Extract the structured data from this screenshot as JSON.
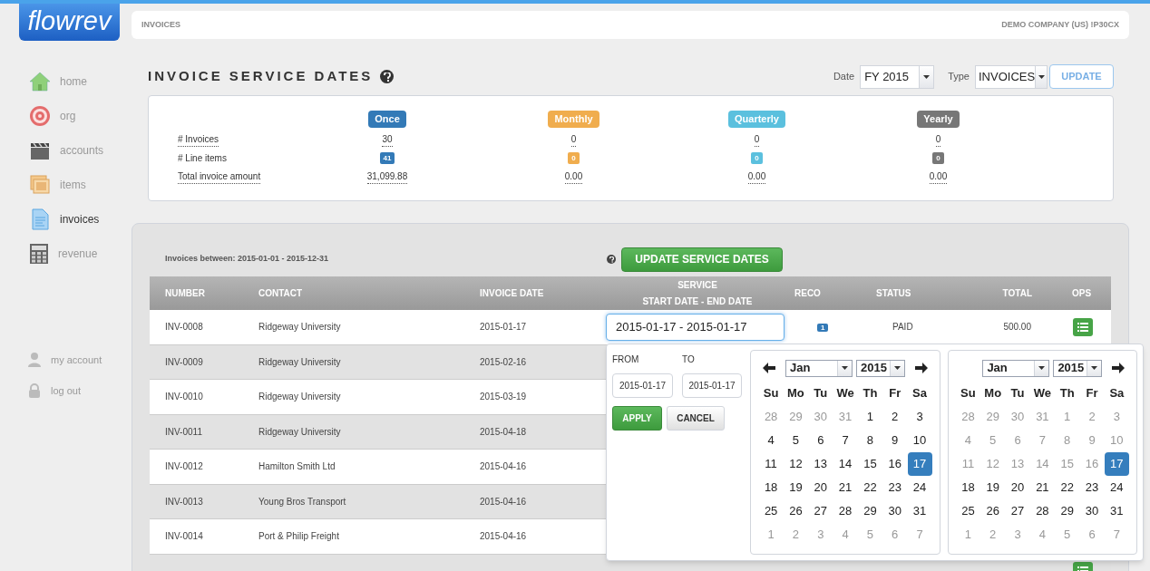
{
  "logo": "flowrev",
  "header": {
    "breadcrumb": "INVOICES",
    "company": "DEMO COMPANY (US) !P30CX"
  },
  "sidebar": {
    "items": [
      {
        "label": "home",
        "kind": "home",
        "selected": false
      },
      {
        "label": "org",
        "kind": "target",
        "selected": false
      },
      {
        "label": "accounts",
        "kind": "clapper",
        "selected": false
      },
      {
        "label": "items",
        "kind": "photos",
        "selected": false
      },
      {
        "label": "invoices",
        "kind": "document",
        "selected": true
      },
      {
        "label": "revenue",
        "kind": "calculator",
        "selected": false
      }
    ],
    "account_items": [
      {
        "label": "my account",
        "kind": "user"
      },
      {
        "label": "log out",
        "kind": "lock"
      }
    ]
  },
  "page_title": "INVOICE SERVICE DATES",
  "filters": {
    "date_label": "Date",
    "date_value": "FY 2015",
    "type_label": "Type",
    "type_value": "INVOICES",
    "update": "UPDATE"
  },
  "summary": {
    "row_labels": [
      "# Invoices",
      "# Line items",
      "Total invoice amount"
    ],
    "columns": [
      {
        "label": "Once",
        "color": "#337ab7",
        "invoices": "30",
        "line_items": "41",
        "total": "31,099.88"
      },
      {
        "label": "Monthly",
        "color": "#f0ad4e",
        "invoices": "0",
        "line_items": "0",
        "total": "0.00"
      },
      {
        "label": "Quarterly",
        "color": "#5bc0de",
        "invoices": "0",
        "line_items": "0",
        "total": "0.00"
      },
      {
        "label": "Yearly",
        "color": "#777777",
        "invoices": "0",
        "line_items": "0",
        "total": "0.00"
      }
    ]
  },
  "invoices_between": "Invoices between: 2015-01-01 - 2015-12-31",
  "update_service_dates": "UPDATE SERVICE DATES",
  "table": {
    "columns": [
      {
        "label": "NUMBER"
      },
      {
        "label": "CONTACT"
      },
      {
        "label": "INVOICE DATE"
      },
      {
        "label": "SERVICE",
        "sublabel": "START DATE - END DATE"
      },
      {
        "label": "RECO"
      },
      {
        "label": "STATUS"
      },
      {
        "label": "TOTAL"
      },
      {
        "label": "OPS"
      }
    ],
    "rows": [
      {
        "number": "INV-0008",
        "contact": "Ridgeway University",
        "invoice_date": "2015-01-17",
        "service": "2015-01-17 - 2015-01-17",
        "reco": "1",
        "status": "PAID",
        "total": "500.00",
        "ops": true
      },
      {
        "number": "INV-0009",
        "contact": "Ridgeway University",
        "invoice_date": "2015-02-16"
      },
      {
        "number": "INV-0010",
        "contact": "Ridgeway University",
        "invoice_date": "2015-03-19"
      },
      {
        "number": "INV-0011",
        "contact": "Ridgeway University",
        "invoice_date": "2015-04-18"
      },
      {
        "number": "INV-0012",
        "contact": "Hamilton Smith Ltd",
        "invoice_date": "2015-04-16"
      },
      {
        "number": "INV-0013",
        "contact": "Young Bros Transport",
        "invoice_date": "2015-04-16"
      },
      {
        "number": "INV-0014",
        "contact": "Port & Philip Freight",
        "invoice_date": "2015-04-16"
      },
      {
        "ops": true
      }
    ]
  },
  "date_picker": {
    "from_label": "FROM",
    "from_value": "2015-01-17",
    "to_label": "TO",
    "to_value": "2015-01-17",
    "apply": "APPLY",
    "cancel": "CANCEL",
    "calendars": [
      {
        "prev_arrow": true,
        "next_arrow": true,
        "month": "Jan",
        "year": "2015",
        "weekdays": [
          "Su",
          "Mo",
          "Tu",
          "We",
          "Th",
          "Fr",
          "Sa"
        ],
        "days": [
          {
            "label": "28",
            "muted": true,
            "selected": false
          },
          {
            "label": "29",
            "muted": true,
            "selected": false
          },
          {
            "label": "30",
            "muted": true,
            "selected": false
          },
          {
            "label": "31",
            "muted": true,
            "selected": false
          },
          {
            "label": "1",
            "muted": false,
            "selected": false
          },
          {
            "label": "2",
            "muted": false,
            "selected": false
          },
          {
            "label": "3",
            "muted": false,
            "selected": false
          },
          {
            "label": "4",
            "muted": false,
            "selected": false
          },
          {
            "label": "5",
            "muted": false,
            "selected": false
          },
          {
            "label": "6",
            "muted": false,
            "selected": false
          },
          {
            "label": "7",
            "muted": false,
            "selected": false
          },
          {
            "label": "8",
            "muted": false,
            "selected": false
          },
          {
            "label": "9",
            "muted": false,
            "selected": false
          },
          {
            "label": "10",
            "muted": false,
            "selected": false
          },
          {
            "label": "11",
            "muted": false,
            "selected": false
          },
          {
            "label": "12",
            "muted": false,
            "selected": false
          },
          {
            "label": "13",
            "muted": false,
            "selected": false
          },
          {
            "label": "14",
            "muted": false,
            "selected": false
          },
          {
            "label": "15",
            "muted": false,
            "selected": false
          },
          {
            "label": "16",
            "muted": false,
            "selected": false
          },
          {
            "label": "17",
            "selected": true
          },
          {
            "label": "18",
            "muted": false,
            "selected": false
          },
          {
            "label": "19",
            "muted": false,
            "selected": false
          },
          {
            "label": "20",
            "muted": false,
            "selected": false
          },
          {
            "label": "21",
            "muted": false,
            "selected": false
          },
          {
            "label": "22",
            "muted": false,
            "selected": false
          },
          {
            "label": "23",
            "muted": false,
            "selected": false
          },
          {
            "label": "24",
            "muted": false,
            "selected": false
          },
          {
            "label": "25",
            "muted": false,
            "selected": false
          },
          {
            "label": "26",
            "muted": false,
            "selected": false
          },
          {
            "label": "27",
            "muted": false,
            "selected": false
          },
          {
            "label": "28",
            "muted": false,
            "selected": false
          },
          {
            "label": "29",
            "muted": false,
            "selected": false
          },
          {
            "label": "30",
            "muted": false,
            "selected": false
          },
          {
            "label": "31",
            "muted": false,
            "selected": false
          },
          {
            "label": "1",
            "muted": true,
            "selected": false
          },
          {
            "label": "2",
            "muted": true,
            "selected": false
          },
          {
            "label": "3",
            "muted": true,
            "selected": false
          },
          {
            "label": "4",
            "muted": true,
            "selected": false
          },
          {
            "label": "5",
            "muted": true,
            "selected": false
          },
          {
            "label": "6",
            "muted": true,
            "selected": false
          },
          {
            "label": "7",
            "muted": true,
            "selected": false
          }
        ]
      },
      {
        "prev_arrow": false,
        "next_arrow": true,
        "month": "Jan",
        "year": "2015",
        "weekdays": [
          "Su",
          "Mo",
          "Tu",
          "We",
          "Th",
          "Fr",
          "Sa"
        ],
        "days": [
          {
            "label": "28",
            "muted": true,
            "selected": false
          },
          {
            "label": "29",
            "muted": true,
            "selected": false
          },
          {
            "label": "30",
            "muted": true,
            "selected": false
          },
          {
            "label": "31",
            "muted": true,
            "selected": false
          },
          {
            "label": "1",
            "muted": true,
            "selected": false
          },
          {
            "label": "2",
            "muted": true,
            "selected": false
          },
          {
            "label": "3",
            "muted": true,
            "selected": false
          },
          {
            "label": "4",
            "muted": true,
            "selected": false
          },
          {
            "label": "5",
            "muted": true,
            "selected": false
          },
          {
            "label": "6",
            "muted": true,
            "selected": false
          },
          {
            "label": "7",
            "muted": true,
            "selected": false
          },
          {
            "label": "8",
            "muted": true,
            "selected": false
          },
          {
            "label": "9",
            "muted": true,
            "selected": false
          },
          {
            "label": "10",
            "muted": true,
            "selected": false
          },
          {
            "label": "11",
            "muted": true,
            "selected": false
          },
          {
            "label": "12",
            "muted": true,
            "selected": false
          },
          {
            "label": "13",
            "muted": true,
            "selected": false
          },
          {
            "label": "14",
            "muted": true,
            "selected": false
          },
          {
            "label": "15",
            "muted": true,
            "selected": false
          },
          {
            "label": "16",
            "muted": true,
            "selected": false
          },
          {
            "label": "17",
            "selected": true
          },
          {
            "label": "18",
            "muted": false,
            "selected": false
          },
          {
            "label": "19",
            "muted": false,
            "selected": false
          },
          {
            "label": "20",
            "muted": false,
            "selected": false
          },
          {
            "label": "21",
            "muted": false,
            "selected": false
          },
          {
            "label": "22",
            "muted": false,
            "selected": false
          },
          {
            "label": "23",
            "muted": false,
            "selected": false
          },
          {
            "label": "24",
            "muted": false,
            "selected": false
          },
          {
            "label": "25",
            "muted": false,
            "selected": false
          },
          {
            "label": "26",
            "muted": false,
            "selected": false
          },
          {
            "label": "27",
            "muted": false,
            "selected": false
          },
          {
            "label": "28",
            "muted": false,
            "selected": false
          },
          {
            "label": "29",
            "muted": false,
            "selected": false
          },
          {
            "label": "30",
            "muted": false,
            "selected": false
          },
          {
            "label": "31",
            "muted": false,
            "selected": false
          },
          {
            "label": "1",
            "muted": true,
            "selected": false
          },
          {
            "label": "2",
            "muted": true,
            "selected": false
          },
          {
            "label": "3",
            "muted": true,
            "selected": false
          },
          {
            "label": "4",
            "muted": true,
            "selected": false
          },
          {
            "label": "5",
            "muted": true,
            "selected": false
          },
          {
            "label": "6",
            "muted": true,
            "selected": false
          },
          {
            "label": "7",
            "muted": true,
            "selected": false
          }
        ]
      }
    ]
  }
}
